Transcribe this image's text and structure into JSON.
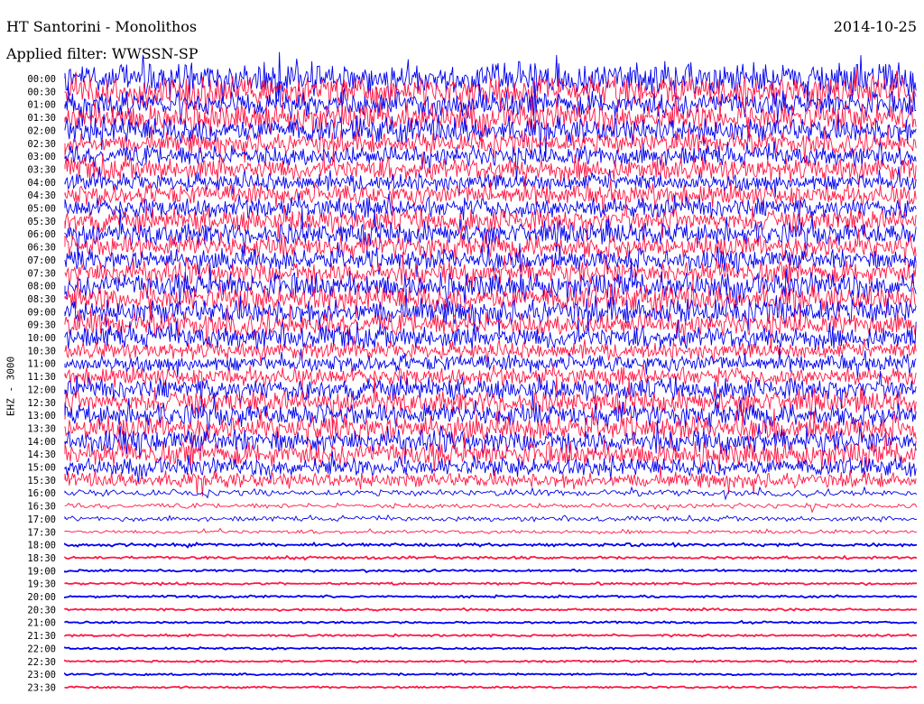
{
  "header": {
    "station": "HT Santorini - Monolithos",
    "date": "2014-10-25",
    "filter": "Applied filter: WWSSN-SP"
  },
  "channel_label": "EHZ - 3000",
  "colors": {
    "blue": "#0000ee",
    "red": "#ff1744"
  },
  "chart_data": {
    "type": "line",
    "title": "HT Santorini - Monolithos",
    "subtitle": "Applied filter: WWSSN-SP",
    "ylabel": "EHZ - 3000",
    "row_labels": [
      "00:00",
      "00:30",
      "01:00",
      "01:30",
      "02:00",
      "02:30",
      "03:00",
      "03:30",
      "04:00",
      "04:30",
      "05:00",
      "05:30",
      "06:00",
      "06:30",
      "07:00",
      "07:30",
      "08:00",
      "08:30",
      "09:00",
      "09:30",
      "10:00",
      "10:30",
      "11:00",
      "11:30",
      "12:00",
      "12:30",
      "13:00",
      "13:30",
      "14:00",
      "14:30",
      "15:00",
      "15:30",
      "16:00",
      "16:30",
      "17:00",
      "17:30",
      "18:00",
      "18:30",
      "19:00",
      "19:30",
      "20:00",
      "20:30",
      "21:00",
      "21:30",
      "22:00",
      "22:30",
      "23:00",
      "23:30"
    ],
    "series_colors": [
      "#0000ee",
      "#ff1744"
    ],
    "relative_amplitude": [
      2.6,
      2.4,
      2.0,
      2.2,
      2.0,
      1.6,
      1.6,
      1.8,
      1.4,
      1.6,
      1.6,
      1.8,
      1.8,
      1.8,
      1.6,
      1.8,
      2.0,
      2.0,
      2.0,
      1.8,
      1.8,
      1.3,
      1.3,
      1.4,
      1.7,
      1.8,
      1.8,
      1.9,
      1.8,
      1.9,
      1.4,
      1.2,
      0.5,
      0.4,
      0.4,
      0.3,
      0.2,
      0.15,
      0.1,
      0.12,
      0.1,
      0.1,
      0.08,
      0.08,
      0.06,
      0.06,
      0.06,
      0.06
    ],
    "grid": false,
    "legend": "none"
  }
}
